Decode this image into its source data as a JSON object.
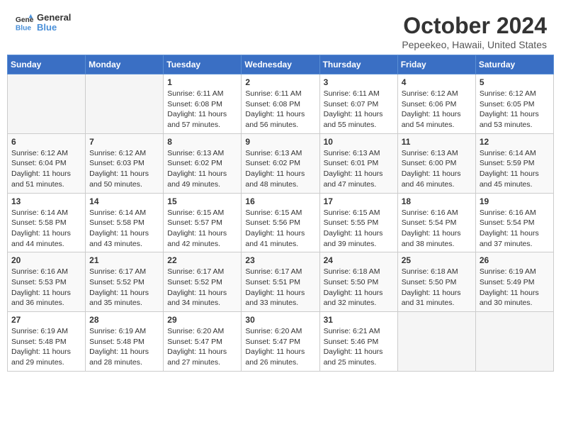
{
  "header": {
    "logo_line1": "General",
    "logo_line2": "Blue",
    "month_title": "October 2024",
    "location": "Pepeekeo, Hawaii, United States"
  },
  "weekdays": [
    "Sunday",
    "Monday",
    "Tuesday",
    "Wednesday",
    "Thursday",
    "Friday",
    "Saturday"
  ],
  "weeks": [
    [
      {
        "day": "",
        "info": ""
      },
      {
        "day": "",
        "info": ""
      },
      {
        "day": "1",
        "info": "Sunrise: 6:11 AM\nSunset: 6:08 PM\nDaylight: 11 hours\nand 57 minutes."
      },
      {
        "day": "2",
        "info": "Sunrise: 6:11 AM\nSunset: 6:08 PM\nDaylight: 11 hours\nand 56 minutes."
      },
      {
        "day": "3",
        "info": "Sunrise: 6:11 AM\nSunset: 6:07 PM\nDaylight: 11 hours\nand 55 minutes."
      },
      {
        "day": "4",
        "info": "Sunrise: 6:12 AM\nSunset: 6:06 PM\nDaylight: 11 hours\nand 54 minutes."
      },
      {
        "day": "5",
        "info": "Sunrise: 6:12 AM\nSunset: 6:05 PM\nDaylight: 11 hours\nand 53 minutes."
      }
    ],
    [
      {
        "day": "6",
        "info": "Sunrise: 6:12 AM\nSunset: 6:04 PM\nDaylight: 11 hours\nand 51 minutes."
      },
      {
        "day": "7",
        "info": "Sunrise: 6:12 AM\nSunset: 6:03 PM\nDaylight: 11 hours\nand 50 minutes."
      },
      {
        "day": "8",
        "info": "Sunrise: 6:13 AM\nSunset: 6:02 PM\nDaylight: 11 hours\nand 49 minutes."
      },
      {
        "day": "9",
        "info": "Sunrise: 6:13 AM\nSunset: 6:02 PM\nDaylight: 11 hours\nand 48 minutes."
      },
      {
        "day": "10",
        "info": "Sunrise: 6:13 AM\nSunset: 6:01 PM\nDaylight: 11 hours\nand 47 minutes."
      },
      {
        "day": "11",
        "info": "Sunrise: 6:13 AM\nSunset: 6:00 PM\nDaylight: 11 hours\nand 46 minutes."
      },
      {
        "day": "12",
        "info": "Sunrise: 6:14 AM\nSunset: 5:59 PM\nDaylight: 11 hours\nand 45 minutes."
      }
    ],
    [
      {
        "day": "13",
        "info": "Sunrise: 6:14 AM\nSunset: 5:58 PM\nDaylight: 11 hours\nand 44 minutes."
      },
      {
        "day": "14",
        "info": "Sunrise: 6:14 AM\nSunset: 5:58 PM\nDaylight: 11 hours\nand 43 minutes."
      },
      {
        "day": "15",
        "info": "Sunrise: 6:15 AM\nSunset: 5:57 PM\nDaylight: 11 hours\nand 42 minutes."
      },
      {
        "day": "16",
        "info": "Sunrise: 6:15 AM\nSunset: 5:56 PM\nDaylight: 11 hours\nand 41 minutes."
      },
      {
        "day": "17",
        "info": "Sunrise: 6:15 AM\nSunset: 5:55 PM\nDaylight: 11 hours\nand 39 minutes."
      },
      {
        "day": "18",
        "info": "Sunrise: 6:16 AM\nSunset: 5:54 PM\nDaylight: 11 hours\nand 38 minutes."
      },
      {
        "day": "19",
        "info": "Sunrise: 6:16 AM\nSunset: 5:54 PM\nDaylight: 11 hours\nand 37 minutes."
      }
    ],
    [
      {
        "day": "20",
        "info": "Sunrise: 6:16 AM\nSunset: 5:53 PM\nDaylight: 11 hours\nand 36 minutes."
      },
      {
        "day": "21",
        "info": "Sunrise: 6:17 AM\nSunset: 5:52 PM\nDaylight: 11 hours\nand 35 minutes."
      },
      {
        "day": "22",
        "info": "Sunrise: 6:17 AM\nSunset: 5:52 PM\nDaylight: 11 hours\nand 34 minutes."
      },
      {
        "day": "23",
        "info": "Sunrise: 6:17 AM\nSunset: 5:51 PM\nDaylight: 11 hours\nand 33 minutes."
      },
      {
        "day": "24",
        "info": "Sunrise: 6:18 AM\nSunset: 5:50 PM\nDaylight: 11 hours\nand 32 minutes."
      },
      {
        "day": "25",
        "info": "Sunrise: 6:18 AM\nSunset: 5:50 PM\nDaylight: 11 hours\nand 31 minutes."
      },
      {
        "day": "26",
        "info": "Sunrise: 6:19 AM\nSunset: 5:49 PM\nDaylight: 11 hours\nand 30 minutes."
      }
    ],
    [
      {
        "day": "27",
        "info": "Sunrise: 6:19 AM\nSunset: 5:48 PM\nDaylight: 11 hours\nand 29 minutes."
      },
      {
        "day": "28",
        "info": "Sunrise: 6:19 AM\nSunset: 5:48 PM\nDaylight: 11 hours\nand 28 minutes."
      },
      {
        "day": "29",
        "info": "Sunrise: 6:20 AM\nSunset: 5:47 PM\nDaylight: 11 hours\nand 27 minutes."
      },
      {
        "day": "30",
        "info": "Sunrise: 6:20 AM\nSunset: 5:47 PM\nDaylight: 11 hours\nand 26 minutes."
      },
      {
        "day": "31",
        "info": "Sunrise: 6:21 AM\nSunset: 5:46 PM\nDaylight: 11 hours\nand 25 minutes."
      },
      {
        "day": "",
        "info": ""
      },
      {
        "day": "",
        "info": ""
      }
    ]
  ]
}
